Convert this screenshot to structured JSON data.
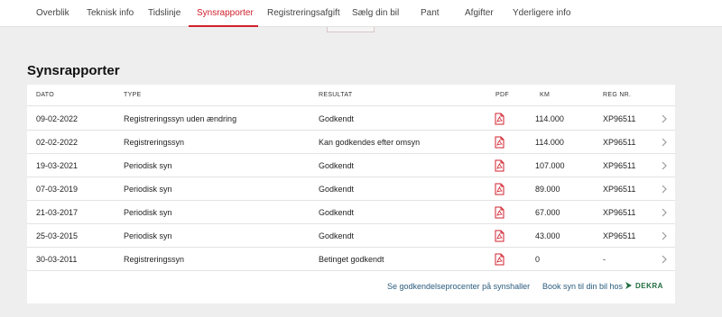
{
  "nav": {
    "tabs": [
      {
        "label": "Overblik"
      },
      {
        "label": "Teknisk info"
      },
      {
        "label": "Tidslinje"
      },
      {
        "label": "Synsrapporter",
        "active": true
      },
      {
        "label": "Registreringsafgift"
      },
      {
        "label": "Sælg din bil"
      },
      {
        "label": "Pant"
      },
      {
        "label": "Afgifter"
      },
      {
        "label": "Yderligere info"
      }
    ],
    "active_color": "#d0202c"
  },
  "section": {
    "title": "Synsrapporter"
  },
  "table": {
    "headers": {
      "dato": "DATO",
      "type": "TYPE",
      "resultat": "RESULTAT",
      "pdf": "PDF",
      "km": "KM",
      "reg": "REG NR."
    },
    "rows": [
      {
        "dato": "09-02-2022",
        "type": "Registreringssyn uden ændring",
        "resultat": "Godkendt",
        "km": "114.000",
        "reg": "XP96511"
      },
      {
        "dato": "02-02-2022",
        "type": "Registreringssyn",
        "resultat": "Kan godkendes efter omsyn",
        "km": "114.000",
        "reg": "XP96511"
      },
      {
        "dato": "19-03-2021",
        "type": "Periodisk syn",
        "resultat": "Godkendt",
        "km": "107.000",
        "reg": "XP96511"
      },
      {
        "dato": "07-03-2019",
        "type": "Periodisk syn",
        "resultat": "Godkendt",
        "km": "89.000",
        "reg": "XP96511"
      },
      {
        "dato": "21-03-2017",
        "type": "Periodisk syn",
        "resultat": "Godkendt",
        "km": "67.000",
        "reg": "XP96511"
      },
      {
        "dato": "25-03-2015",
        "type": "Periodisk syn",
        "resultat": "Godkendt",
        "km": "43.000",
        "reg": "XP96511"
      },
      {
        "dato": "30-03-2011",
        "type": "Registreringssyn",
        "resultat": "Betinget godkendt",
        "km": "0",
        "reg": "-"
      }
    ]
  },
  "footer": {
    "link1": "Se godkendelseprocenter på synshaller",
    "link2": "Book syn til din bil hos",
    "partner": "DEKRA"
  },
  "icons": {
    "pdf": "pdf-file-icon",
    "chevron": "chevron-right-icon",
    "dekra": "dekra-logo-icon"
  },
  "colors": {
    "accent": "#d0202c",
    "link": "#2a5b7d",
    "dekra": "#1f6b3f"
  }
}
